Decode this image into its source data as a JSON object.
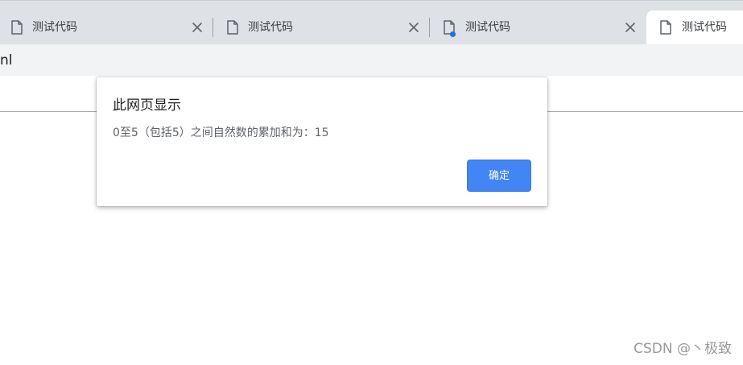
{
  "tabs": [
    {
      "title": "测试代码",
      "close_glyph": "✕",
      "icon": "document-icon"
    },
    {
      "title": "测试代码",
      "close_glyph": "✕",
      "icon": "document-icon"
    },
    {
      "title": "测试代码",
      "close_glyph": "✕",
      "icon": "document-icon",
      "notification": true
    },
    {
      "title": "测试代码",
      "icon": "document-icon",
      "active": true
    }
  ],
  "address_bar": {
    "text": "nl"
  },
  "dialog": {
    "title": "此网页显示",
    "message": "0至5（包括5）之间自然数的累加和为：15",
    "ok_label": "确定"
  },
  "watermark": {
    "text": "CSDN @丶极致"
  },
  "colors": {
    "tabstrip_bg": "#dee1e6",
    "active_tab_bg": "#ffffff",
    "address_bar_bg": "#f1f3f4",
    "ok_button_bg": "#4285f4",
    "notification_dot": "#1a73e8"
  }
}
